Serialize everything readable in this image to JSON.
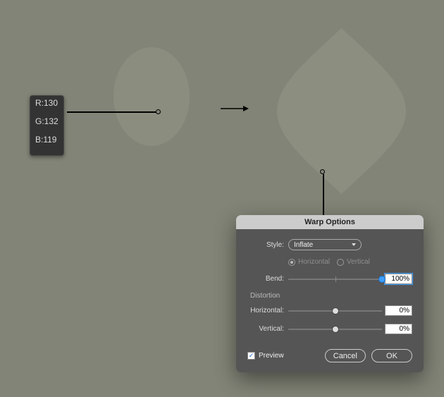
{
  "colorTooltip": {
    "r_label": "R:",
    "r_value": "130",
    "g_label": "G:",
    "g_value": "132",
    "b_label": "B:",
    "b_value": "119"
  },
  "dialog": {
    "title": "Warp Options",
    "style_label": "Style:",
    "style_value": "Inflate",
    "orient_horizontal": "Horizontal",
    "orient_vertical": "Vertical",
    "bend_label": "Bend:",
    "bend_value": "100%",
    "distortion_label": "Distortion",
    "dist_h_label": "Horizontal:",
    "dist_h_value": "0%",
    "dist_v_label": "Vertical:",
    "dist_v_value": "0%",
    "preview_label": "Preview",
    "cancel": "Cancel",
    "ok": "OK"
  }
}
